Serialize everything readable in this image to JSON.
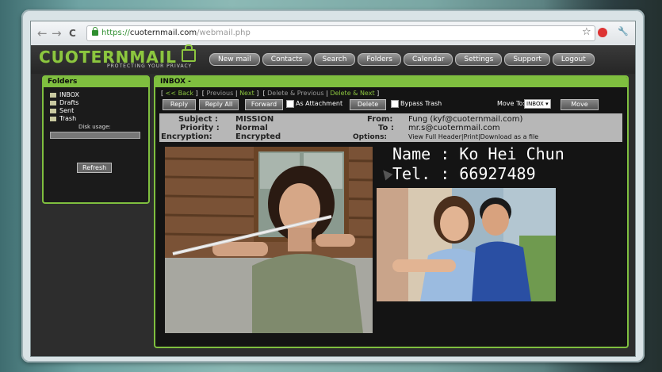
{
  "browser": {
    "nav_back": "←",
    "nav_forward": "→",
    "nav_reload": "C",
    "url_scheme": "https://",
    "url_domain": "cuoternmail.com",
    "url_path": "/webmail.php",
    "star_icon": "☆",
    "wrench_icon": "🔧"
  },
  "app": {
    "logo": "CUOTERNMAIL",
    "tagline": "PROTECTING YOUR PRIVACY",
    "menu": [
      "New mail",
      "Contacts",
      "Search",
      "Folders",
      "Calendar",
      "Settings",
      "Support",
      "Logout"
    ]
  },
  "folders": {
    "title": "Folders",
    "items": [
      "INBOX",
      "Drafts",
      "Sent",
      "Trash"
    ],
    "disk_usage_label": "Disk usage:",
    "refresh_label": "Refresh"
  },
  "inbox": {
    "title": "INBOX -",
    "back": "<< Back",
    "previous": "Previous",
    "next": "Next",
    "delete_previous": "Delete & Previous",
    "delete_next": "Delete & Next",
    "reply": "Reply",
    "reply_all": "Reply All",
    "forward": "Forward",
    "as_attachment": "As Attachment",
    "delete": "Delete",
    "bypass_trash": "Bypass Trash",
    "move_to_label": "Move To:",
    "move_to_value": "INBOX",
    "move_button": "Move"
  },
  "message": {
    "subject_label": "Subject :",
    "subject": "MISSION",
    "priority_label": "Priority :",
    "priority": "Normal",
    "encryption_label": "Encryption:",
    "encryption": "Encrypted",
    "from_label": "From:",
    "from": "Fung (kyf@cuoternmail.com)",
    "to_label": "To :",
    "to": "mr.s@cuoternmail.com",
    "options_label": "Options:",
    "options": "View Full Header|Print|Download as a file",
    "name_line": "Name : Ko Hei Chun",
    "tel_line": "Tel. : 66927489"
  },
  "colors": {
    "accent": "#7fbf3f",
    "header_bg": "#b7b7b7"
  }
}
